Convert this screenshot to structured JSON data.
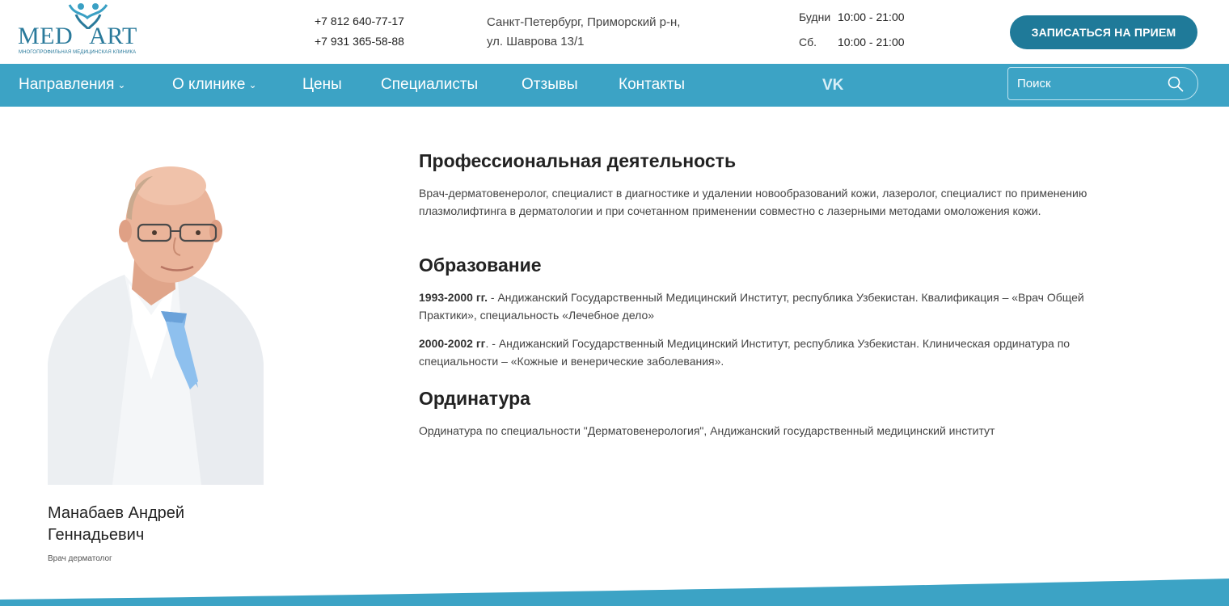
{
  "header": {
    "logo": {
      "word": "MEDVART",
      "subtitle": "МНОГОПРОФИЛЬНАЯ МЕДИЦИНСКАЯ КЛИНИКА"
    },
    "phones": [
      "+7 812 640-77-17",
      "+7 931 365-58-88"
    ],
    "address": [
      "Санкт-Петербург, Приморский р-н,",
      "ул. Шаврова 13/1"
    ],
    "hours": [
      {
        "day": "Будни",
        "time": "10:00 - 21:00"
      },
      {
        "day": "Сб.",
        "time": "10:00 - 21:00"
      }
    ],
    "cta_label": "ЗАПИСАТЬСЯ НА ПРИЕМ"
  },
  "nav": {
    "items": [
      {
        "label": "Направления",
        "dropdown": true
      },
      {
        "label": "О клинике",
        "dropdown": true
      },
      {
        "label": "Цены",
        "dropdown": false
      },
      {
        "label": "Специалисты",
        "dropdown": false
      },
      {
        "label": "Отзывы",
        "dropdown": false
      },
      {
        "label": "Контакты",
        "dropdown": false
      }
    ],
    "social_icon": "vk-icon",
    "search_placeholder": "Поиск"
  },
  "doctor": {
    "name": "Манабаев Андрей Геннадьевич",
    "role": "Врач дерматолог"
  },
  "sections": {
    "professional": {
      "title": "Профессиональная деятельность",
      "text": "Врач-дерматовенеролог, специалист в диагностике и удалении новообразований кожи, лазеролог, специалист по применению плазмолифтинга в дерматологии и при сочетанном применении совместно с лазерными методами омоложения кожи."
    },
    "education": {
      "title": "Образование",
      "items": [
        {
          "years": "1993-2000 гг.",
          "text": " - Андижанский Государственный Медицинский Институт, республика Узбекистан. Квалификация – «Врач Общей Практики», специальность «Лечебное дело»"
        },
        {
          "years": "2000-2002 гг",
          "text": ". - Андижанский Государственный Медицинский Институт, республика Узбекистан. Клиническая ординатура  по специальности – «Кожные и венерические заболевания»."
        }
      ]
    },
    "residency": {
      "title": "Ординатура",
      "text": "Ординатура по специальности \"Дерматовенерология\", Андижанский государственный медицинский институт"
    }
  },
  "colors": {
    "brand": "#1f7a99",
    "nav": "#3ca3c5",
    "text": "#444444"
  }
}
